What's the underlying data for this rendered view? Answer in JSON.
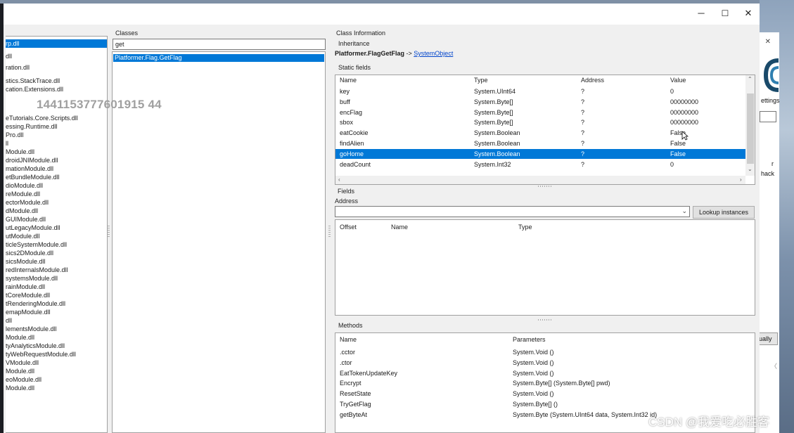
{
  "window": {
    "controls": [
      "─",
      "☐",
      "✕"
    ]
  },
  "assemblies": {
    "items": [
      "rp.dll",
      "dll",
      "ration.dll",
      "stics.StackTrace.dll",
      "cation.Extensions.dll",
      "eTutorials.Core.Scripts.dll",
      "essing.Runtime.dll",
      "Pro.dll",
      "ll",
      "Module.dll",
      "droidJNIModule.dll",
      "mationModule.dll",
      "etBundleModule.dll",
      "dioModule.dll",
      "reModule.dll",
      "ectorModule.dll",
      "dModule.dll",
      "GUIModule.dll",
      "utLegacyModule.dll",
      "utModule.dll",
      "ticleSystemModule.dll",
      "sics2DModule.dll",
      "sicsModule.dll",
      "redInternalsModule.dll",
      "systemsModule.dll",
      "rainModule.dll",
      "tCoreModule.dll",
      "tRenderingModule.dll",
      "emapModule.dll",
      "dll",
      "lementsModule.dll",
      "Module.dll",
      "tyAnalyticsModule.dll",
      "tyWebRequestModule.dll",
      "VModule.dll",
      "Module.dll",
      "eoModule.dll",
      "Module.dll"
    ],
    "selected_index": 0
  },
  "classes": {
    "label": "Classes",
    "search_value": "get",
    "items": [
      "Platformer.Flag.GetFlag"
    ]
  },
  "class_info": {
    "label": "Class Information",
    "inheritance_label": "Inheritance",
    "class_name": "Platformer.FlagGetFlag",
    "arrow": " -> ",
    "base_class": "SystemObject"
  },
  "static_fields": {
    "label": "Static fields",
    "columns": [
      "Name",
      "Type",
      "Address",
      "Value"
    ],
    "rows": [
      {
        "name": "key",
        "type": "System.UInt64",
        "address": "?",
        "value": "0"
      },
      {
        "name": "buff",
        "type": "System.Byte[]",
        "address": "?",
        "value": "00000000"
      },
      {
        "name": "encFlag",
        "type": "System.Byte[]",
        "address": "?",
        "value": "00000000"
      },
      {
        "name": "sbox",
        "type": "System.Byte[]",
        "address": "?",
        "value": "00000000"
      },
      {
        "name": "eatCookie",
        "type": "System.Boolean",
        "address": "?",
        "value": "False"
      },
      {
        "name": "findAlien",
        "type": "System.Boolean",
        "address": "?",
        "value": "False"
      },
      {
        "name": "goHome",
        "type": "System.Boolean",
        "address": "?",
        "value": "False"
      },
      {
        "name": "deadCount",
        "type": "System.Int32",
        "address": "?",
        "value": "0"
      }
    ],
    "selected_index": 6
  },
  "fields": {
    "label": "Fields",
    "address_label": "Address",
    "address_value": "",
    "lookup_button": "Lookup instances",
    "columns": [
      "Offset",
      "Name",
      "Type"
    ]
  },
  "methods": {
    "label": "Methods",
    "columns": [
      "Name",
      "Parameters"
    ],
    "rows": [
      {
        "name": ".cctor",
        "params": "System.Void ()"
      },
      {
        "name": ".ctor",
        "params": "System.Void ()"
      },
      {
        "name": "EatTokenUpdateKey",
        "params": "System.Void ()"
      },
      {
        "name": "Encrypt",
        "params": "System.Byte[] (System.Byte[] pwd)"
      },
      {
        "name": "ResetState",
        "params": "System.Void ()"
      },
      {
        "name": "TryGetFlag",
        "params": "System.Byte[] ()"
      },
      {
        "name": "getByteAt",
        "params": "System.Byte (System.UInt64 data, System.Int32 id)"
      }
    ]
  },
  "background_window": {
    "settings_text": "ettings",
    "r_text": "r",
    "hack_text": "hack",
    "button_text": "ually"
  },
  "watermarks": {
    "user_id": "1441153777601915 44",
    "csdn": "CSDN @我爱吃必胜客"
  },
  "colors": {
    "selection": "#0078d7",
    "link": "#0044cc",
    "panel_bg": "#f0f0f0"
  }
}
